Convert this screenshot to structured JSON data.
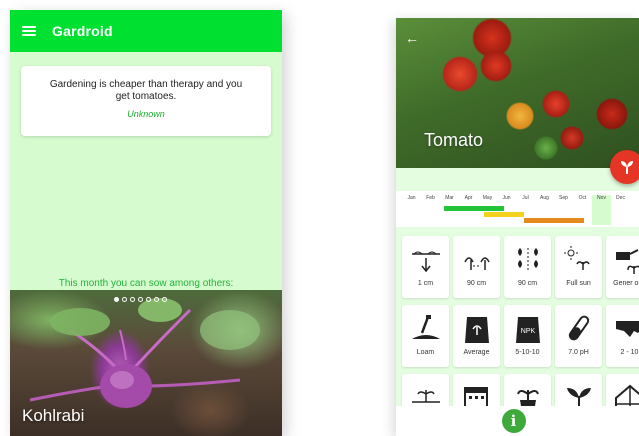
{
  "left_screen": {
    "app_title": "Gardroid",
    "quote": {
      "text": "Gardening is cheaper than therapy and you get tomatoes.",
      "author": "Unknown"
    },
    "sow_heading": "This month you can sow among others:",
    "featured_plant": "Kohlrabi",
    "carousel": {
      "total_dots": 7,
      "active_dot": 0
    }
  },
  "right_screen": {
    "plant_name": "Tomato",
    "calendar": {
      "months": [
        "Jan",
        "Feb",
        "Mar",
        "Apr",
        "May",
        "Jun",
        "Jul",
        "Aug",
        "Sep",
        "Oct",
        "Nov",
        "Dec"
      ],
      "current_month": "Nov",
      "colors": {
        "sow": "#22c43a",
        "plant": "#f2d21a",
        "harvest": "#e58a1f",
        "highlight": "#d6fbcf"
      }
    },
    "tiles": [
      {
        "icon": "sowing-depth-icon",
        "label": "1 cm"
      },
      {
        "icon": "plant-spacing-icon",
        "label": "90 cm"
      },
      {
        "icon": "row-spacing-icon",
        "label": "90 cm"
      },
      {
        "icon": "sun-exposure-icon",
        "label": "Full sun"
      },
      {
        "icon": "watering-icon",
        "label": "Gener ous"
      },
      {
        "icon": "soil-type-icon",
        "label": "Loam"
      },
      {
        "icon": "fertilizer-bag-icon",
        "label": "Average"
      },
      {
        "icon": "npk-bag-icon",
        "label": "5-10-10"
      },
      {
        "icon": "ph-test-tube-icon",
        "label": "7.0 pH"
      },
      {
        "icon": "climate-zone-map-icon",
        "label": "2 - 10"
      },
      {
        "icon": "germination-icon",
        "label": ""
      },
      {
        "icon": "calendar-icon",
        "label": ""
      },
      {
        "icon": "potted-plant-icon",
        "label": ""
      },
      {
        "icon": "seedling-icon",
        "label": ""
      },
      {
        "icon": "greenhouse-icon",
        "label": ""
      }
    ],
    "info_button_label": "i"
  }
}
